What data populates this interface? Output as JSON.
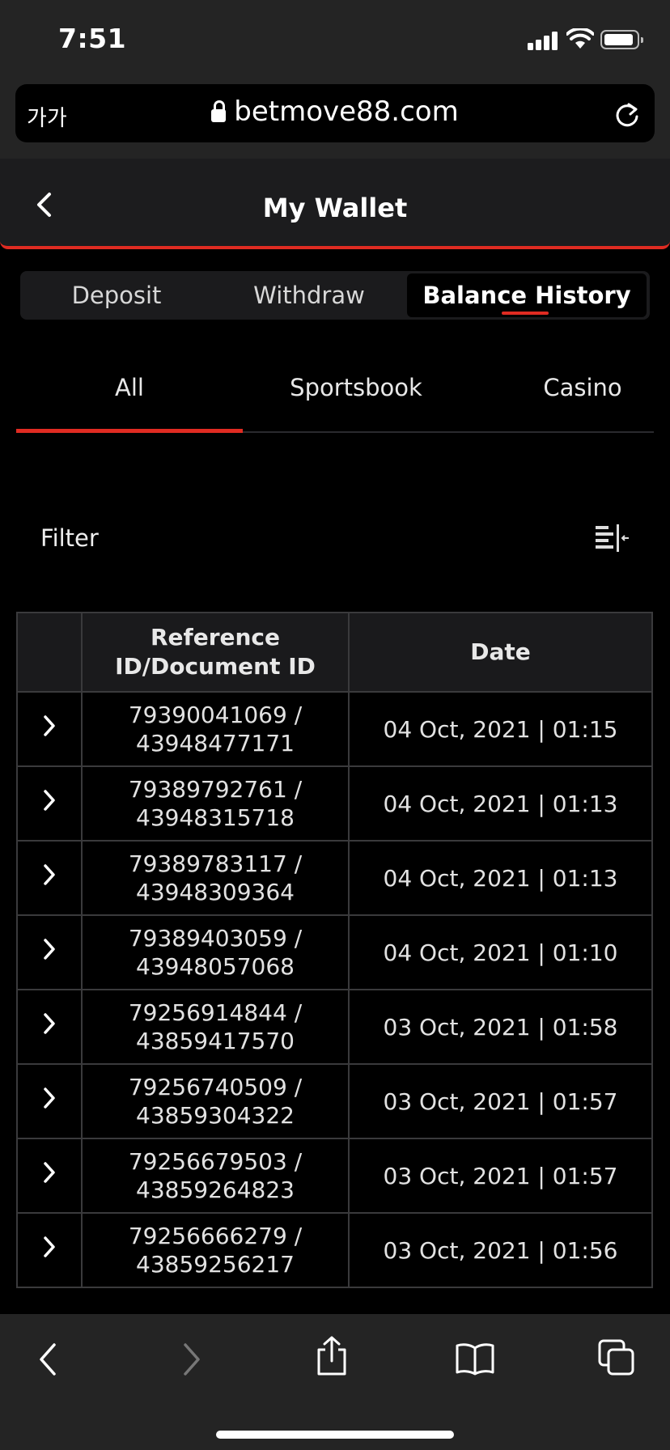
{
  "status_bar": {
    "time": "7:51"
  },
  "browser": {
    "aa_label": "가가",
    "url": "betmove88.com"
  },
  "header": {
    "title": "My Wallet"
  },
  "segments": [
    {
      "label": "Deposit"
    },
    {
      "label": "Withdraw"
    },
    {
      "label": "Balance History",
      "active": true
    }
  ],
  "category_tabs": [
    {
      "label": "All",
      "active": true
    },
    {
      "label": "Sportsbook"
    },
    {
      "label": "Casino"
    }
  ],
  "filter": {
    "label": "Filter"
  },
  "table": {
    "headers": {
      "ref_line1": "Reference",
      "ref_line2": "ID/Document ID",
      "date": "Date"
    },
    "rows": [
      {
        "ref": "79390041069 /",
        "doc": "43948477171",
        "date": "04 Oct, 2021 | 01:15"
      },
      {
        "ref": "79389792761 /",
        "doc": "43948315718",
        "date": "04 Oct, 2021 | 01:13"
      },
      {
        "ref": "79389783117 /",
        "doc": "43948309364",
        "date": "04 Oct, 2021 | 01:13"
      },
      {
        "ref": "79389403059 /",
        "doc": "43948057068",
        "date": "04 Oct, 2021 | 01:10"
      },
      {
        "ref": "79256914844 /",
        "doc": "43859417570",
        "date": "03 Oct, 2021 | 01:58"
      },
      {
        "ref": "79256740509 /",
        "doc": "43859304322",
        "date": "03 Oct, 2021 | 01:57"
      },
      {
        "ref": "79256679503 /",
        "doc": "43859264823",
        "date": "03 Oct, 2021 | 01:57"
      },
      {
        "ref": "79256666279 /",
        "doc": "43859256217",
        "date": "03 Oct, 2021 | 01:56"
      }
    ]
  },
  "colors": {
    "accent": "#e02b22",
    "background": "#000000",
    "chrome": "#242424"
  }
}
